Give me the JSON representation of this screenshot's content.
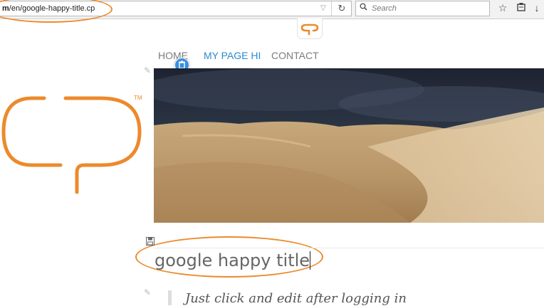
{
  "browser": {
    "url_prefix": "m",
    "url_rest": "/en/google-happy-title.cp",
    "search_placeholder": "Search",
    "icons": [
      "dropdown-arrow-icon",
      "reload-icon",
      "search-icon",
      "bookmark-star-icon",
      "reading-list-icon",
      "download-icon",
      "home-icon"
    ]
  },
  "nav": {
    "items": [
      {
        "label": "HOME",
        "active": false
      },
      {
        "label": "MY PAGE HI",
        "active": true
      },
      {
        "label": "CONTACT",
        "active": false
      }
    ]
  },
  "logo": {
    "trademark": "TM"
  },
  "content": {
    "title": "google happy title",
    "subtitle": "Just click and edit after logging in"
  },
  "colors": {
    "accent": "#ec8a2c",
    "nav_active": "#2a8bd0",
    "trash_button": "#3a8ee0"
  }
}
